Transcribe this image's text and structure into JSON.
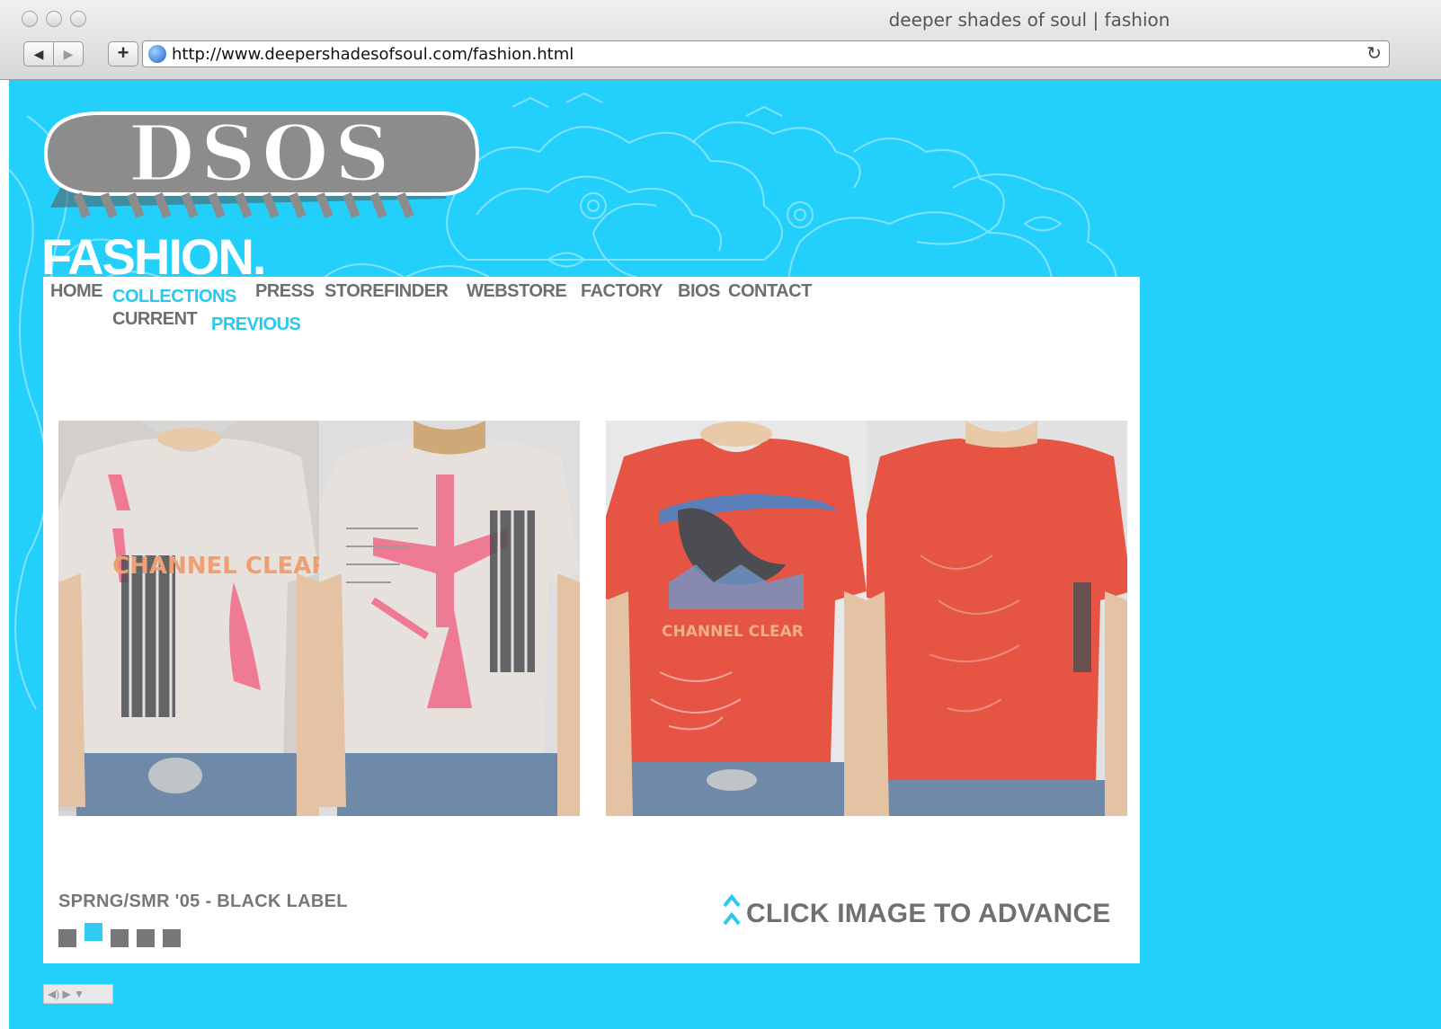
{
  "window": {
    "title": "deeper shades of soul | fashion",
    "url": "http://www.deepershadesofsoul.com/fashion.html",
    "back_glyph": "◀",
    "forward_glyph": "▶",
    "add_glyph": "+",
    "reload_glyph": "↻"
  },
  "page": {
    "title": "FASHION.",
    "logo_text": "DSOS",
    "nav": {
      "home": "HOME",
      "collections": "COLLECTIONS",
      "press": "PRESS",
      "storefinder": "STOREFINDER",
      "webstore": "WEBSTORE",
      "factory": "FACTORY",
      "bios": "BIOS",
      "contact": "CONTACT"
    },
    "subnav": {
      "current": "CURRENT",
      "previous": "PREVIOUS"
    },
    "collection_label": "SPRNG/SMR '05 - BLACK LABEL",
    "advance_label": "CLICK IMAGE TO ADVANCE",
    "shirt_print_text": "CHANNEL CLEAR",
    "pagination": {
      "total": 5,
      "active_index": 1
    },
    "media_controls": "◀) ▶ ▼"
  },
  "colors": {
    "background": "#22d0fb",
    "accent": "#27c9ee",
    "nav_text": "#6e6e6e",
    "logo_gray": "#8c8c8c",
    "shirt_light": "#e6e1dc",
    "shirt_red": "#e65444",
    "shirt_pink": "#ef7a93"
  }
}
